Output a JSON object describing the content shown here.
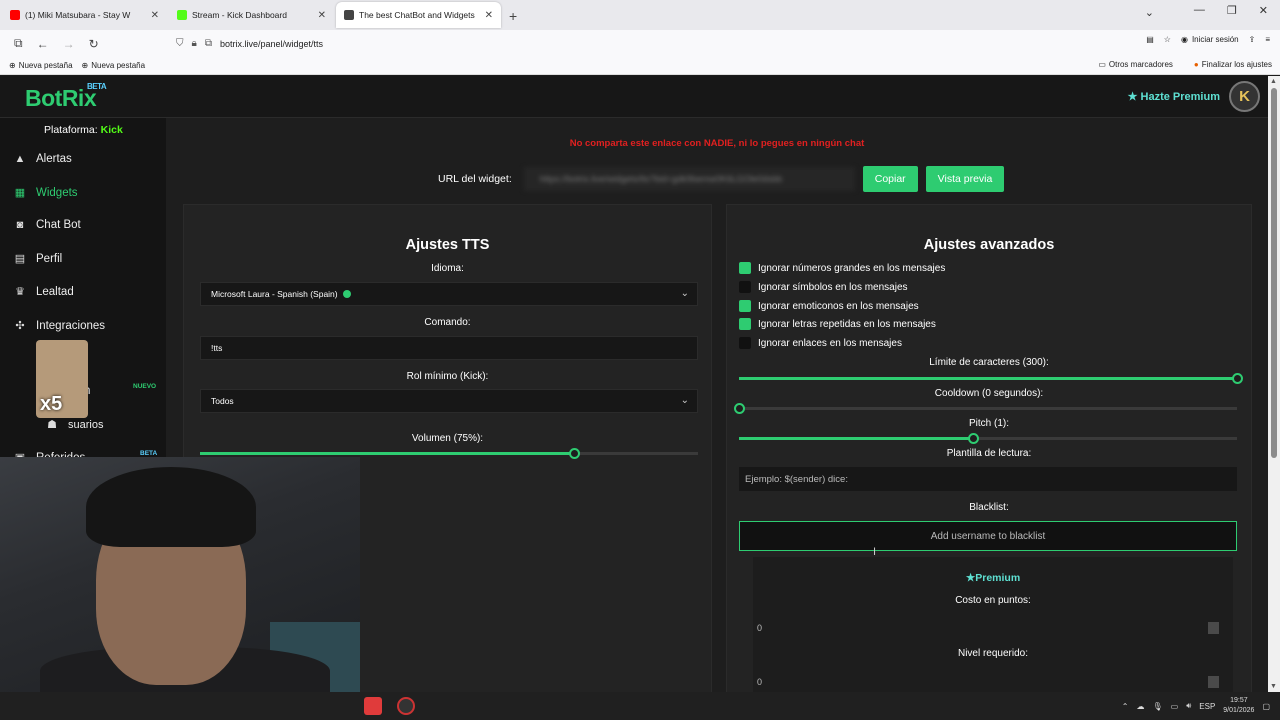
{
  "browser": {
    "tabs": [
      {
        "label": "(1) Miki Matsubara - Stay W",
        "color": "#ff0000"
      },
      {
        "label": "Stream - Kick Dashboard",
        "color": "#53fc18"
      },
      {
        "label": "The best ChatBot and Widgets",
        "color": "#333333"
      }
    ],
    "url": "botrix.live/panel/widget/tts",
    "login_label": "Iniciar sesión",
    "bookmarks": [
      "Nueva pestaña",
      "Nueva pestaña"
    ],
    "bookmarks_right": [
      "Otros marcadores",
      "Finalizar los ajustes"
    ]
  },
  "header": {
    "logo": "BotRix",
    "beta": "BETA",
    "premium": "Hazte Premium",
    "avatar_letter": "K"
  },
  "sidebar": {
    "platform_label": "Plataforma:",
    "platform_value": "Kick",
    "items": [
      {
        "label": "Alertas",
        "icon": "alert-icon"
      },
      {
        "label": "Widgets",
        "icon": "grid-icon"
      },
      {
        "label": "Chat Bot",
        "icon": "robot-icon"
      },
      {
        "label": "Perfil",
        "icon": "id-card-icon"
      },
      {
        "label": "Lealtad",
        "icon": "trophy-icon"
      },
      {
        "label": "Integraciones",
        "icon": "puzzle-icon"
      },
      {
        "label": "s",
        "icon": "partial"
      },
      {
        "label": "n",
        "icon": "partial"
      },
      {
        "label": "suarios",
        "icon": "users-icon"
      },
      {
        "label": "Referidos",
        "icon": "gift-icon"
      }
    ],
    "badge_new": "NUEVO",
    "badge_beta": "BETA",
    "sticker_text": "x5"
  },
  "widget": {
    "warning": "No comparta este enlace con NADIE, ni lo pegues en ningún chat",
    "url_label": "URL del widget:",
    "url_value": "https://botrix.live/widgets/tts?bid=gdk9bemw0K6LGOle0dsbb",
    "copy_button": "Copiar",
    "preview_button": "Vista previa"
  },
  "tts": {
    "title": "Ajustes TTS",
    "language_label": "Idioma:",
    "language_value": "Microsoft Laura - Spanish (Spain)",
    "command_label": "Comando:",
    "command_value": "!tts",
    "role_label": "Rol mínimo (Kick):",
    "role_value": "Todos",
    "volume_label": "Volumen (75%):",
    "volume": 0.75
  },
  "advanced": {
    "title": "Ajustes avanzados",
    "checkboxes": [
      {
        "label": "Ignorar números grandes en los mensajes",
        "checked": true
      },
      {
        "label": "Ignorar símbolos en los mensajes",
        "checked": false
      },
      {
        "label": "Ignorar emoticonos en los mensajes",
        "checked": true
      },
      {
        "label": "Ignorar letras repetidas en los mensajes",
        "checked": true
      },
      {
        "label": "Ignorar enlaces en los mensajes",
        "checked": false
      }
    ],
    "char_limit_label": "Límite de caracteres (300):",
    "char_limit": 1.0,
    "cooldown_label": "Cooldown (0 segundos):",
    "cooldown": 0.0,
    "pitch_label": "Pitch (1):",
    "pitch": 0.47,
    "template_label": "Plantilla de lectura:",
    "template_placeholder": "Ejemplo: $(sender) dice:",
    "blacklist_label": "Blacklist:",
    "blacklist_placeholder": "Add username to blacklist",
    "premium_tag": "Premium",
    "cost_label": "Costo en puntos:",
    "cost_value": "0",
    "level_label": "Nivel requerido:",
    "level_value": "0"
  },
  "taskbar": {
    "lang": "ESP",
    "time": "19:57",
    "date": "9/01/2026"
  }
}
